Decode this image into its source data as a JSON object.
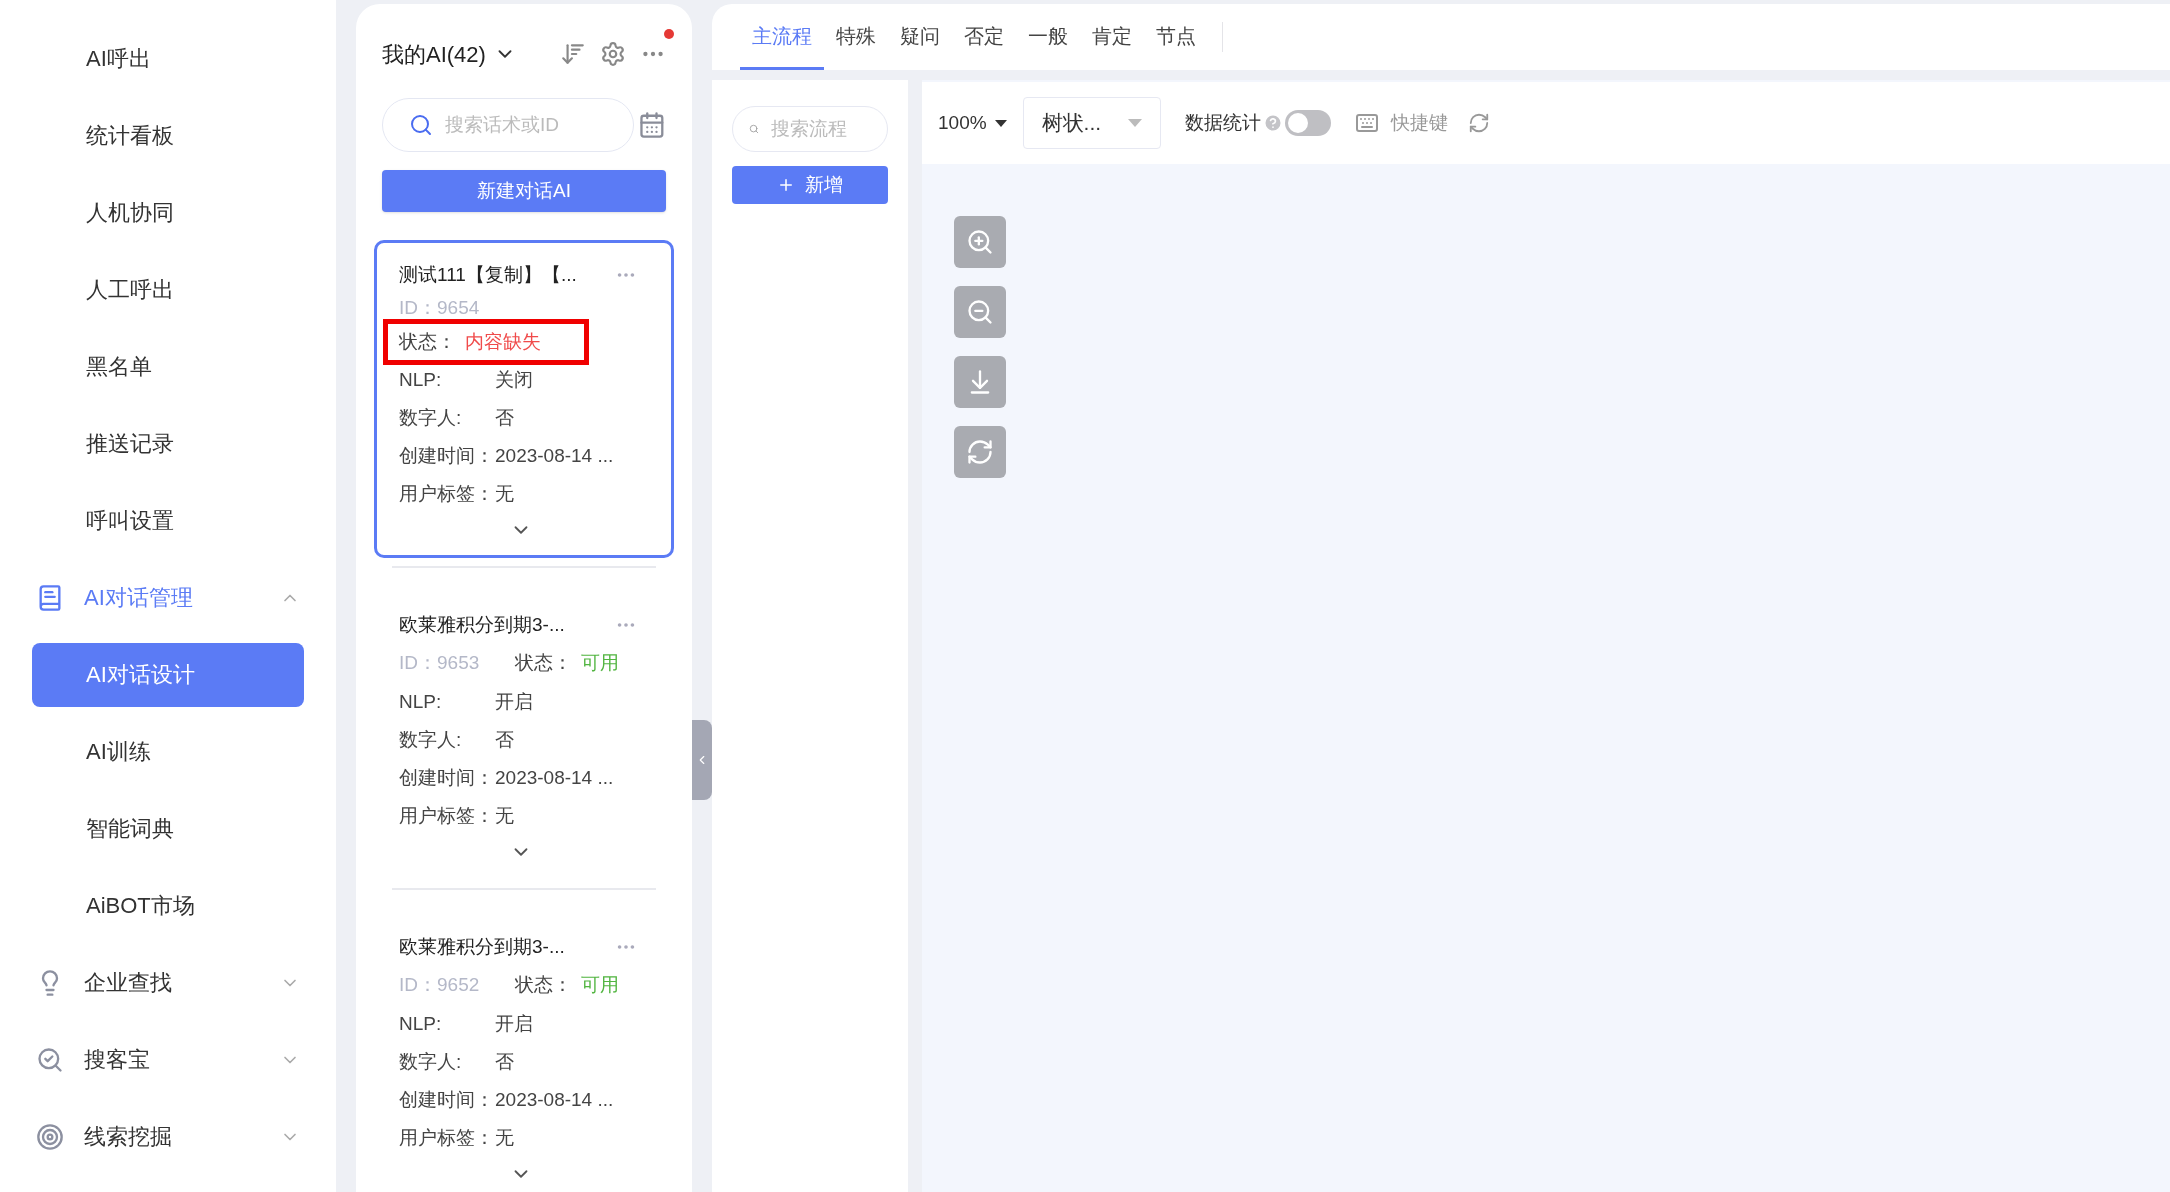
{
  "sidebar": {
    "items": [
      {
        "kind": "item",
        "label": "AI呼出",
        "selected": false
      },
      {
        "kind": "item",
        "label": "统计看板",
        "selected": false
      },
      {
        "kind": "item",
        "label": "人机协同",
        "selected": false
      },
      {
        "kind": "item",
        "label": "人工呼出",
        "selected": false
      },
      {
        "kind": "item",
        "label": "黑名单",
        "selected": false
      },
      {
        "kind": "item",
        "label": "推送记录",
        "selected": false
      },
      {
        "kind": "item",
        "label": "呼叫设置",
        "selected": false
      },
      {
        "kind": "group",
        "label": "AI对话管理",
        "expanded": true,
        "active": true
      },
      {
        "kind": "item",
        "label": "AI对话设计",
        "selected": true
      },
      {
        "kind": "item",
        "label": "AI训练",
        "selected": false
      },
      {
        "kind": "item",
        "label": "智能词典",
        "selected": false
      },
      {
        "kind": "item",
        "label": "AiBOT市场",
        "selected": false
      },
      {
        "kind": "group",
        "label": "企业查找",
        "expanded": false,
        "active": false
      },
      {
        "kind": "group",
        "label": "搜客宝",
        "expanded": false,
        "active": false
      },
      {
        "kind": "group",
        "label": "线索挖掘",
        "expanded": false,
        "active": false
      }
    ]
  },
  "list_panel": {
    "title": "我的AI(42)",
    "notification_dot": true,
    "search": {
      "placeholder": "搜索话术或ID"
    },
    "new_button": "新建对话AI",
    "cards": [
      {
        "kind": "stacked",
        "selected": true,
        "highlighted": true,
        "title": "测试111【复制】【...",
        "id_label": "ID：",
        "id": "9654",
        "status_label": "状态：",
        "status": "内容缺失",
        "color": "#f04b4b",
        "nlp_label": "NLP:",
        "nlp": "关闭",
        "digital_label": "数字人:",
        "digital": "否",
        "created_label": "创建时间：",
        "created": "2023-08-14 ...",
        "tags_label": "用户标签：",
        "tags": "无"
      },
      {
        "kind": "inline",
        "selected": false,
        "title": "欧莱雅积分到期3-...",
        "id_label": "ID：",
        "id": "9653",
        "status_label": "状态：",
        "status": "可用",
        "color": "#52b541",
        "nlp_label": "NLP:",
        "nlp": "开启",
        "digital_label": "数字人:",
        "digital": "否",
        "created_label": "创建时间：",
        "created": "2023-08-14 ...",
        "tags_label": "用户标签：",
        "tags": "无"
      },
      {
        "kind": "inline",
        "selected": false,
        "title": "欧莱雅积分到期3-...",
        "id_label": "ID：",
        "id": "9652",
        "status_label": "状态：",
        "status": "可用",
        "color": "#52b541",
        "nlp_label": "NLP:",
        "nlp": "开启",
        "digital_label": "数字人:",
        "digital": "否",
        "created_label": "创建时间：",
        "created": "2023-08-14 ...",
        "tags_label": "用户标签：",
        "tags": "无"
      }
    ]
  },
  "tabs": [
    {
      "label": "主流程",
      "selected": true
    },
    {
      "label": "特殊",
      "selected": false
    },
    {
      "label": "疑问",
      "selected": false
    },
    {
      "label": "否定",
      "selected": false
    },
    {
      "label": "一般",
      "selected": false
    },
    {
      "label": "肯定",
      "selected": false
    },
    {
      "label": "节点",
      "selected": false
    }
  ],
  "flow_panel": {
    "search": {
      "placeholder": "搜索流程"
    },
    "add_button": "新增"
  },
  "toolbar": {
    "zoom": "100%",
    "layout": "树状...",
    "stats_label": "数据统计",
    "stats_on": false,
    "shortcut": "快捷键"
  }
}
